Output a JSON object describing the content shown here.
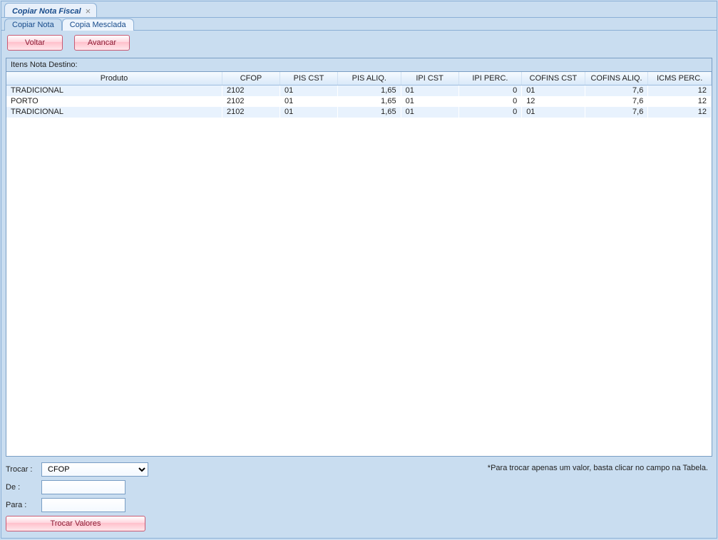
{
  "windowTab": {
    "title": "Copiar Nota Fiscal"
  },
  "subTabs": {
    "active": "Copiar Nota",
    "inactive": "Copia Mesclada"
  },
  "toolbar": {
    "voltar": "Voltar",
    "avancar": "Avancar"
  },
  "tableTitle": "Itens Nota Destino:",
  "columns": {
    "produto": "Produto",
    "cfop": "CFOP",
    "pis_cst": "PIS CST",
    "pis_aliq": "PIS ALIQ.",
    "ipi_cst": "IPI CST",
    "ipi_perc": "IPI PERC.",
    "cofins_cst": "COFINS CST",
    "cofins_aliq": "COFINS ALIQ.",
    "icms_perc": "ICMS PERC."
  },
  "rows": [
    {
      "produto": "TRADICIONAL",
      "cfop": "2102",
      "pis_cst": "01",
      "pis_aliq": "1,65",
      "ipi_cst": "01",
      "ipi_perc": "0",
      "cofins_cst": "01",
      "cofins_aliq": "7,6",
      "icms_perc": "12"
    },
    {
      "produto": "PORTO",
      "cfop": "2102",
      "pis_cst": "01",
      "pis_aliq": "1,65",
      "ipi_cst": "01",
      "ipi_perc": "0",
      "cofins_cst": "12",
      "cofins_aliq": "7,6",
      "icms_perc": "12"
    },
    {
      "produto": "TRADICIONAL",
      "cfop": "2102",
      "pis_cst": "01",
      "pis_aliq": "1,65",
      "ipi_cst": "01",
      "ipi_perc": "0",
      "cofins_cst": "01",
      "cofins_aliq": "7,6",
      "icms_perc": "12"
    }
  ],
  "swap": {
    "trocarLabel": "Trocar :",
    "deLabel": "De :",
    "paraLabel": "Para :",
    "selected": "CFOP",
    "deValue": "",
    "paraValue": "",
    "button": "Trocar Valores"
  },
  "hint": "*Para trocar apenas um valor, basta clicar no campo na Tabela."
}
